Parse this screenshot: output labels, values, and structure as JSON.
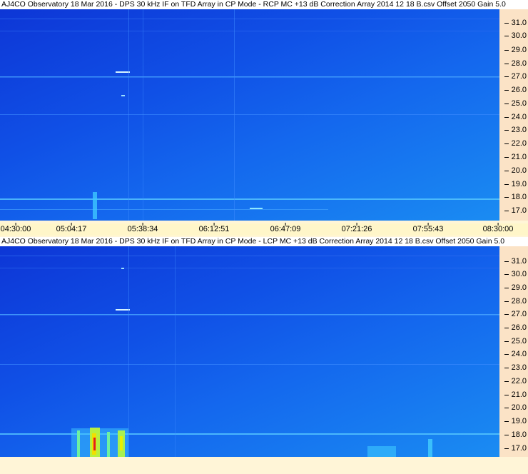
{
  "panels": [
    {
      "title": "AJ4CO Observatory 18 Mar 2016 - DPS 30 kHz IF on TFD Array in CP Mode - RCP  MC +13 dB  Correction Array 2014 12 18 B.csv  Offset 2050  Gain 5.0",
      "freq_ticks": [
        "31.0",
        "30.0",
        "29.0",
        "28.0",
        "27.0",
        "26.0",
        "25.0",
        "24.0",
        "23.0",
        "22.0",
        "21.0",
        "20.0",
        "19.0",
        "18.0",
        "17.0"
      ]
    },
    {
      "title": "AJ4CO Observatory 18 Mar 2016 - DPS 30 kHz IF on TFD Array in CP Mode - LCP  MC +13 dB  Correction Array 2014 12 18 B.csv  Offset 2050  Gain 5.0",
      "freq_ticks": [
        "31.0",
        "30.0",
        "29.0",
        "28.0",
        "27.0",
        "26.0",
        "25.0",
        "24.0",
        "23.0",
        "22.0",
        "21.0",
        "20.0",
        "19.0",
        "18.0",
        "17.0"
      ]
    }
  ],
  "time_ticks": [
    "04:30:00",
    "05:04:17",
    "05:38:34",
    "06:12:51",
    "06:47:09",
    "07:21:26",
    "07:55:43",
    "08:30:00"
  ],
  "colors": {
    "background_low": "#0d36d6",
    "background_high": "#1a8cf2",
    "burst": "#e8f000",
    "burst_core": "#e02020"
  }
}
